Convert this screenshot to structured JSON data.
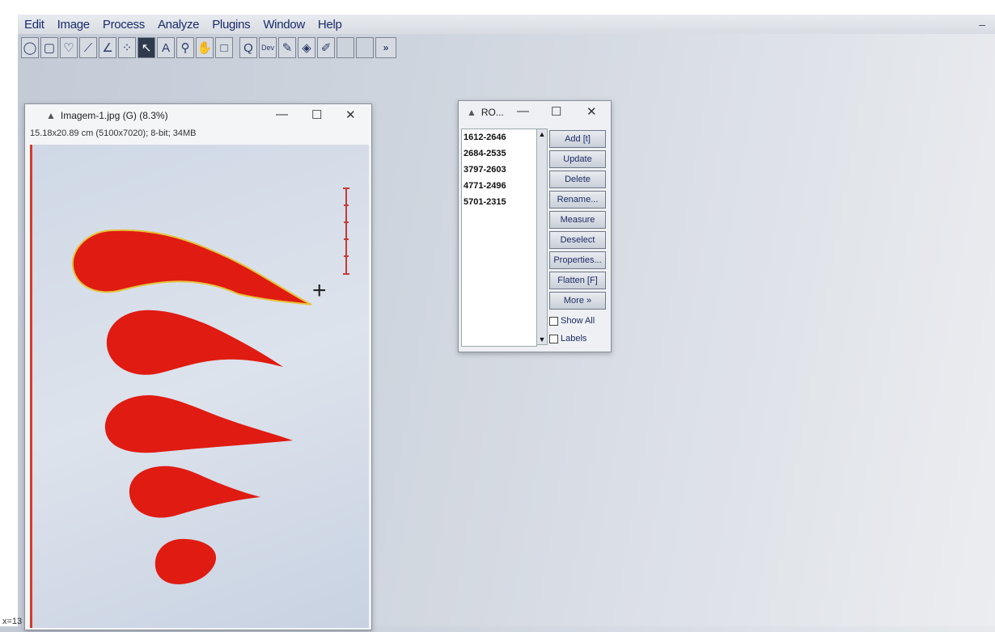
{
  "menu": {
    "items": [
      "Edit",
      "Image",
      "Process",
      "Analyze",
      "Plugins",
      "Window",
      "Help"
    ],
    "right_glyph": "–"
  },
  "toolbar": {
    "tools": [
      {
        "name": "oval-selection-tool",
        "glyph": "◯"
      },
      {
        "name": "polygon-selection-tool",
        "glyph": "▢"
      },
      {
        "name": "freehand-selection-tool",
        "glyph": "♡"
      },
      {
        "name": "line-tool",
        "glyph": "⟋"
      },
      {
        "name": "angle-tool",
        "glyph": "∠"
      },
      {
        "name": "point-tool",
        "glyph": "⁘"
      },
      {
        "name": "wand-tool",
        "glyph": "↖"
      },
      {
        "name": "text-tool",
        "glyph": "A"
      },
      {
        "name": "magnifier-tool",
        "glyph": "⚲"
      },
      {
        "name": "hand-tool",
        "glyph": "✋"
      },
      {
        "name": "color-picker-tool",
        "glyph": "□"
      },
      {
        "name": "search-tool",
        "glyph": "Q"
      },
      {
        "name": "developer-menu-tool",
        "glyph": "Dev"
      },
      {
        "name": "brush-tool",
        "glyph": "✎"
      },
      {
        "name": "flood-fill-tool",
        "glyph": "◈"
      },
      {
        "name": "pencil-tool",
        "glyph": "✐"
      },
      {
        "name": "empty-slot-1",
        "glyph": ""
      },
      {
        "name": "empty-slot-2",
        "glyph": ""
      },
      {
        "name": "more-tools",
        "glyph": "»"
      }
    ],
    "active_tool": "wand-tool"
  },
  "image_window": {
    "title": "Imagem-1.jpg (G) (8.3%)",
    "subtitle": "15.18x20.89 cm (5100x7020); 8-bit; 34MB",
    "minimize": "—",
    "maximize": "☐",
    "close": "✕",
    "crosshair": "+",
    "scale_bar_color": "#c73a34"
  },
  "roi_manager": {
    "title": "RO...",
    "minimize": "—",
    "maximize": "☐",
    "close": "✕",
    "items": [
      "1612-2646",
      "2684-2535",
      "3797-2603",
      "4771-2496",
      "5701-2315"
    ],
    "buttons": [
      "Add [t]",
      "Update",
      "Delete",
      "Rename...",
      "Measure",
      "Deselect",
      "Properties...",
      "Flatten [F]",
      "More »"
    ],
    "checkboxes": [
      "Show All",
      "Labels"
    ]
  },
  "status": {
    "coord_text": "x=13"
  },
  "colors": {
    "selection_fill": "#e01b12",
    "selection_outline": "#e6c23a"
  }
}
